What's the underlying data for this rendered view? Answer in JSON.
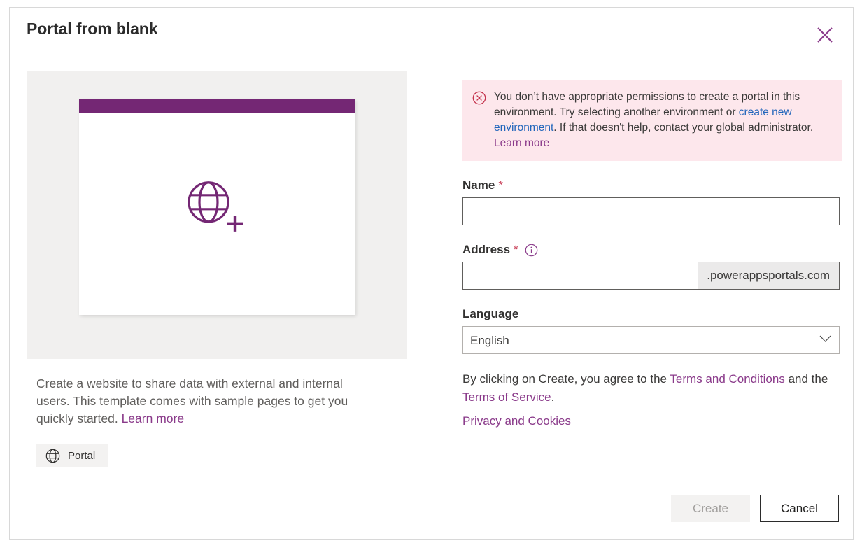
{
  "dialog": {
    "title": "Portal from blank",
    "close_icon": "close-icon"
  },
  "preview": {
    "icon": "globe-plus-icon"
  },
  "description": {
    "text_before_link": "Create a website to share data with external and internal users. This template comes with sample pages to get you quickly started. ",
    "link_label": "Learn more"
  },
  "tag": {
    "icon": "globe-icon",
    "label": "Portal"
  },
  "error": {
    "icon": "error-circle-x-icon",
    "part1": "You don’t have appropriate permissions to create a portal in this environment. Try selecting another environment or ",
    "link1": "create new environment",
    "part2": ". If that doesn't help, contact your global administrator. ",
    "link2": "Learn more"
  },
  "form": {
    "name": {
      "label": "Name",
      "required_marker": "*",
      "value": "",
      "placeholder": ""
    },
    "address": {
      "label": "Address",
      "required_marker": "*",
      "info_icon": "info-circle-icon",
      "value": "",
      "placeholder": "",
      "suffix": ".powerappsportals.com"
    },
    "language": {
      "label": "Language",
      "selected": "English",
      "options": [
        "English"
      ],
      "chevron_icon": "chevron-down-icon"
    }
  },
  "terms": {
    "prefix": "By clicking on Create, you agree to the ",
    "link_terms_conditions": "Terms and Conditions",
    "middle": " and the ",
    "link_terms_service": "Terms of Service",
    "suffix": ".",
    "privacy_link": "Privacy and Cookies"
  },
  "footer": {
    "create_label": "Create",
    "cancel_label": "Cancel"
  },
  "colors": {
    "brand_purple": "#742774",
    "link_purple": "#8a3a8a",
    "error_bg": "#fde7ec",
    "error_red": "#c4314b",
    "link_blue": "#2266bb"
  }
}
